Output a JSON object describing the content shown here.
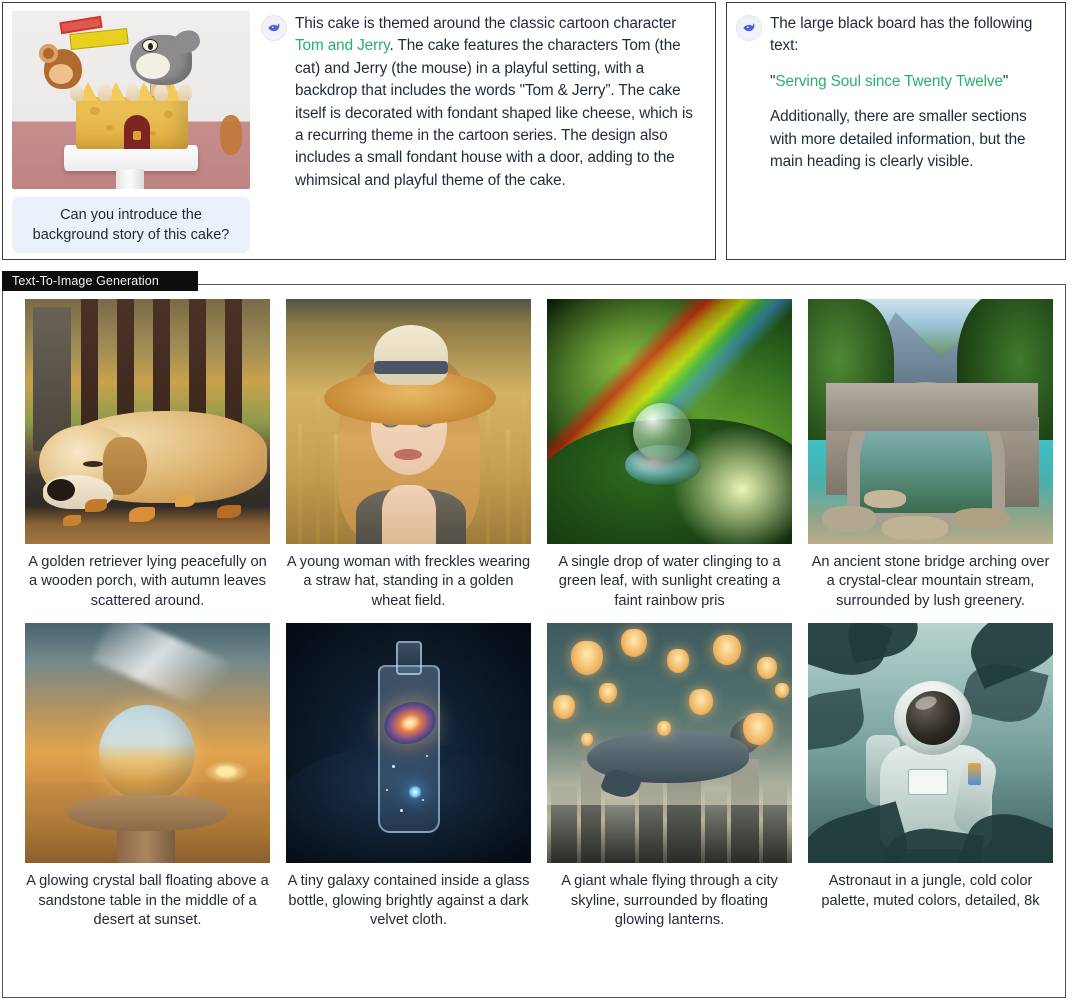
{
  "conversations": [
    {
      "id": "cake-qa",
      "avatar_icon": "whale-logo-icon",
      "image_alt": "Tom and Jerry themed cheese cake on a white stand",
      "user_message": "Can you introduce the background story of this cake?",
      "answer_prefix": "This cake is themed around the classic cartoon character ",
      "answer_highlight": "Tom and Jerry",
      "answer_suffix": ". The cake features the characters Tom (the cat) and Jerry (the mouse) in a playful setting, with a backdrop that includes the words \"Tom & Jerry”. The cake itself is decorated with fondant shaped like cheese, which is a recurring theme in the cartoon series. The design also includes a small fondant house with a door, adding to the whimsical and playful theme of the cake."
    },
    {
      "id": "blackboard-qa",
      "avatar_icon": "whale-logo-icon",
      "line1": "The large black board has the following text:",
      "quote_open": "\"",
      "quote_highlight": "Serving Soul since Twenty Twelve",
      "quote_close": "\"",
      "line3": "Additionally, there are smaller sections with more detailed information, but the main heading is clearly visible."
    }
  ],
  "section": {
    "badge": "Text-To-Image Generation",
    "rows": [
      {
        "cells": [
          {
            "name": "golden-retriever",
            "caption": "A golden retriever lying peacefully on a wooden porch, with autumn leaves scattered around."
          },
          {
            "name": "young-woman-wheat-field",
            "caption": "A young woman with freckles wearing a straw hat, standing in a golden wheat field."
          },
          {
            "name": "water-drop-leaf",
            "caption": "A single drop of water clinging to a green leaf, with sunlight creating a faint rainbow pris"
          },
          {
            "name": "stone-bridge",
            "caption": "An ancient stone bridge arching over a crystal-clear mountain stream, surrounded by lush greenery."
          }
        ]
      },
      {
        "cells": [
          {
            "name": "crystal-ball-desert",
            "caption": "A glowing crystal ball floating above a sandstone table in the middle of a desert at sunset."
          },
          {
            "name": "galaxy-in-bottle",
            "caption": "A tiny galaxy contained inside a glass bottle, glowing brightly against a dark velvet cloth."
          },
          {
            "name": "whale-over-city",
            "caption": "A giant whale flying through a city skyline, surrounded by floating glowing lanterns."
          },
          {
            "name": "astronaut-jungle",
            "caption": "Astronaut in a jungle, cold color palette, muted colors, detailed, 8k"
          }
        ]
      }
    ]
  },
  "colors": {
    "highlight_green": "#27b06a",
    "user_bubble_bg": "#eaf1fb",
    "badge_bg": "#0d0d0d",
    "text": "#1f2b3a",
    "brand_blue": "#4a63d8"
  }
}
